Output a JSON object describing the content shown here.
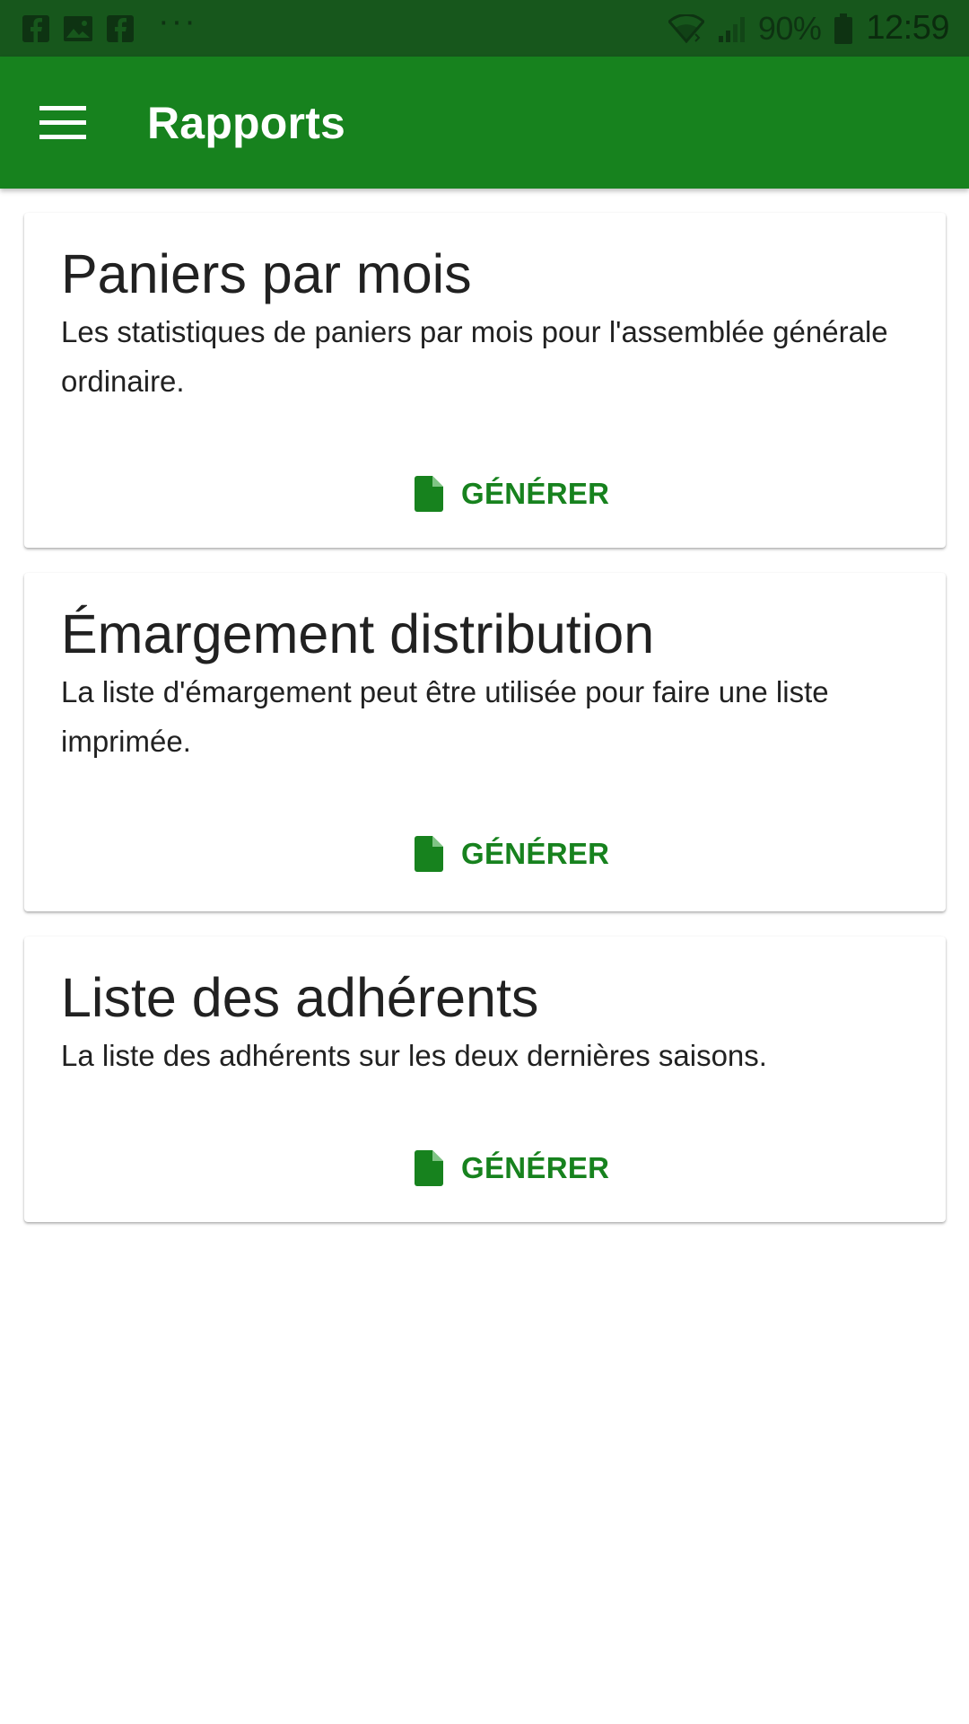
{
  "status_bar": {
    "battery": "90%",
    "time": "12:59",
    "more": "···",
    "icons": [
      "facebook-icon",
      "image-icon",
      "facebook-icon",
      "wifi-icon",
      "signal-icon",
      "battery-icon"
    ]
  },
  "app_bar": {
    "title": "Rapports",
    "menu_icon": "hamburger-menu-icon"
  },
  "colors": {
    "status_bar": "#17571c",
    "primary": "#17821e",
    "text": "#212121"
  },
  "cards": [
    {
      "title": "Paniers par mois",
      "description": "Les statistiques de paniers par mois pour l'assemblée générale ordinaire.",
      "action_label": "GÉNÉRER",
      "action_icon": "file-icon"
    },
    {
      "title": "Émargement distribution",
      "description": "La liste d'émargement peut être utilisée pour faire une liste imprimée.",
      "action_label": "GÉNÉRER",
      "action_icon": "file-icon"
    },
    {
      "title": "Liste des adhérents",
      "description": "La liste des adhérents sur les deux dernières saisons.",
      "action_label": "GÉNÉRER",
      "action_icon": "file-icon"
    }
  ]
}
